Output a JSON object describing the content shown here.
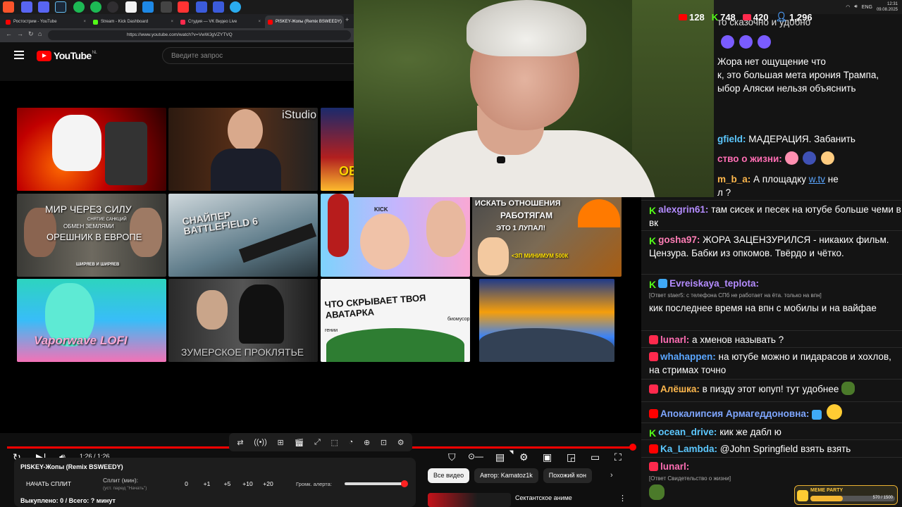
{
  "browser": {
    "tabs": [
      {
        "label": "Ростострим - YouTube",
        "color": "#ff0000"
      },
      {
        "label": "Stream - Kick Dashboard",
        "color": "#53fc18"
      },
      {
        "label": "Студия — VK Видео Live",
        "color": "#ff2a4d"
      },
      {
        "label": "PISKEY-Жопы (Remix BSWEEDY)",
        "color": "#ff0000",
        "active": true
      }
    ],
    "url": "https://www.youtube.com/watch?v=VwWJgVZYTVQ"
  },
  "taskbar": {
    "lang": "ENG",
    "time": "12:31",
    "date": "09.08.2025"
  },
  "youtube": {
    "logo": "YouTube",
    "logo_country": "NL",
    "search_placeholder": "Введите запрос",
    "thumbs": [
      {
        "text": ""
      },
      {
        "text": "iStudio"
      },
      {
        "text": "ОБ"
      },
      {
        "text": "МИР ЧЕРЕЗ СИЛУ",
        "sub1": "СНЯТИЕ САНКЦИЙ",
        "sub2": "ОБМЕН ЗЕМЛЯМИ",
        "sub3": "ОРЕШНИК В ЕВРОПЕ",
        "brand": "ШИРЯЕВ И ШИРЯЕВ"
      },
      {
        "text": "СНАЙПЕР BATTLEFIELD 6"
      },
      {
        "text": "KICK"
      },
      {
        "text": "ИСКАТЬ ОТНОШЕНИЯ",
        "sub1": "РАБОТЯГАМ",
        "sub2": "ЭТО 1 ЛУПАЛ!",
        "sub3": "<ЗП МИНИМУМ 500К"
      },
      {
        "text": "Vaporwave LOFI"
      },
      {
        "text": "ЗУМЕРСКОЕ ПРОКЛЯТЬЕ"
      },
      {
        "text": "ЧТО СКРЫВАЕТ ТВОЯ АВАТАРКА",
        "sub1": "гении",
        "sub2": "биомусор"
      },
      {
        "text": ""
      }
    ],
    "player": {
      "time": "1:26 / 1:26",
      "progress": 1.0
    },
    "panel": {
      "title": "PISKEY-Жопы (Remix BSWEEDY)",
      "split_button": "НАЧАТЬ СПЛИТ",
      "split_label": "Сплит (мин):",
      "split_hint": "(уст. паред \"Начать\")",
      "increments": [
        "0",
        "+1",
        "+5",
        "+10",
        "+20"
      ],
      "volume_label": "Громк. алерта:",
      "volume": 0.95,
      "bought": "Выкуплено: 0 / Всего: ? минут"
    },
    "chips": [
      "Все видео",
      "Автор: Kamatoz1k",
      "Похожий кон"
    ],
    "rec_title": "Сектантское аниме"
  },
  "stream": {
    "viewers": [
      {
        "platform": "youtube",
        "count": "128",
        "color": "#ff0000"
      },
      {
        "platform": "kick",
        "count": "748",
        "color": "#53fc18"
      },
      {
        "platform": "vk",
        "count": "420",
        "color": "#ff2a4d"
      },
      {
        "platform": "total",
        "count": "1,296",
        "color": "#4ea1ff"
      }
    ]
  },
  "chat": {
    "top_fragments": [
      "то сказочно и удобно",
      "Жора нет ощущение что",
      "к, это большая мета ирония Трампа,",
      "ыбор Аляски нельзя объяснить",
      "gfield:",
      "МАДЕРАЦИЯ. Забанить",
      "ство о жизни:",
      "m_b_a:",
      "А площадку",
      "w.tv",
      "не",
      "л ?"
    ],
    "messages": [
      {
        "platform": "kick",
        "nick": "alexgrin61:",
        "color": "#b48cff",
        "text": "там сисек и песек на ютубе больше чеми в вк"
      },
      {
        "platform": "kick",
        "nick": "gosha97:",
        "color": "#ff7eb6",
        "text": "ЖОРА ЗАЦЕНЗУРИЛСЯ - никаких фильм. Цензура. Бабки из опкомов. Твёрдо и чётко."
      },
      {
        "platform": "kick",
        "nick": "Evreiskaya_teplota:",
        "color": "#b48cff",
        "reply": "[Ответ staer5: с телефона СПб не работает на ёта. только на впн]",
        "text": "кик последнее время на впн с мобилы и на вайфае"
      },
      {
        "platform": "vk",
        "nick": "lunarl:",
        "color": "#ff6eb4",
        "text": "а хменов называть ?"
      },
      {
        "platform": "vk",
        "nick": "whahappen:",
        "color": "#5aa6ff",
        "text": "на ютубе можно и пидарасов и хохлов, на стримах точно"
      },
      {
        "platform": "vk",
        "nick": "Алёшка:",
        "color": "#ffb84d",
        "text": "в пизду этот юпуп! тут удобнее"
      },
      {
        "platform": "youtube",
        "nick": "Апокалипсия Армагеддоновна:",
        "color": "#7ea6ff",
        "text": ""
      },
      {
        "platform": "kick",
        "nick": "ocean_drive:",
        "color": "#5cc8ff",
        "text": "кик же дабл ю"
      },
      {
        "platform": "youtube",
        "nick": "Ka_Lambda:",
        "color": "#5cc8ff",
        "text": "@John Springfield взять взять"
      },
      {
        "platform": "vk",
        "nick": "lunarl:",
        "color": "#ff6eb4",
        "reply": "[Ответ Свидетельство о жизни]",
        "text": ""
      }
    ]
  },
  "meme_party": {
    "label": "MEME PARTY",
    "count": "570 / 1500",
    "progress": 0.38
  }
}
